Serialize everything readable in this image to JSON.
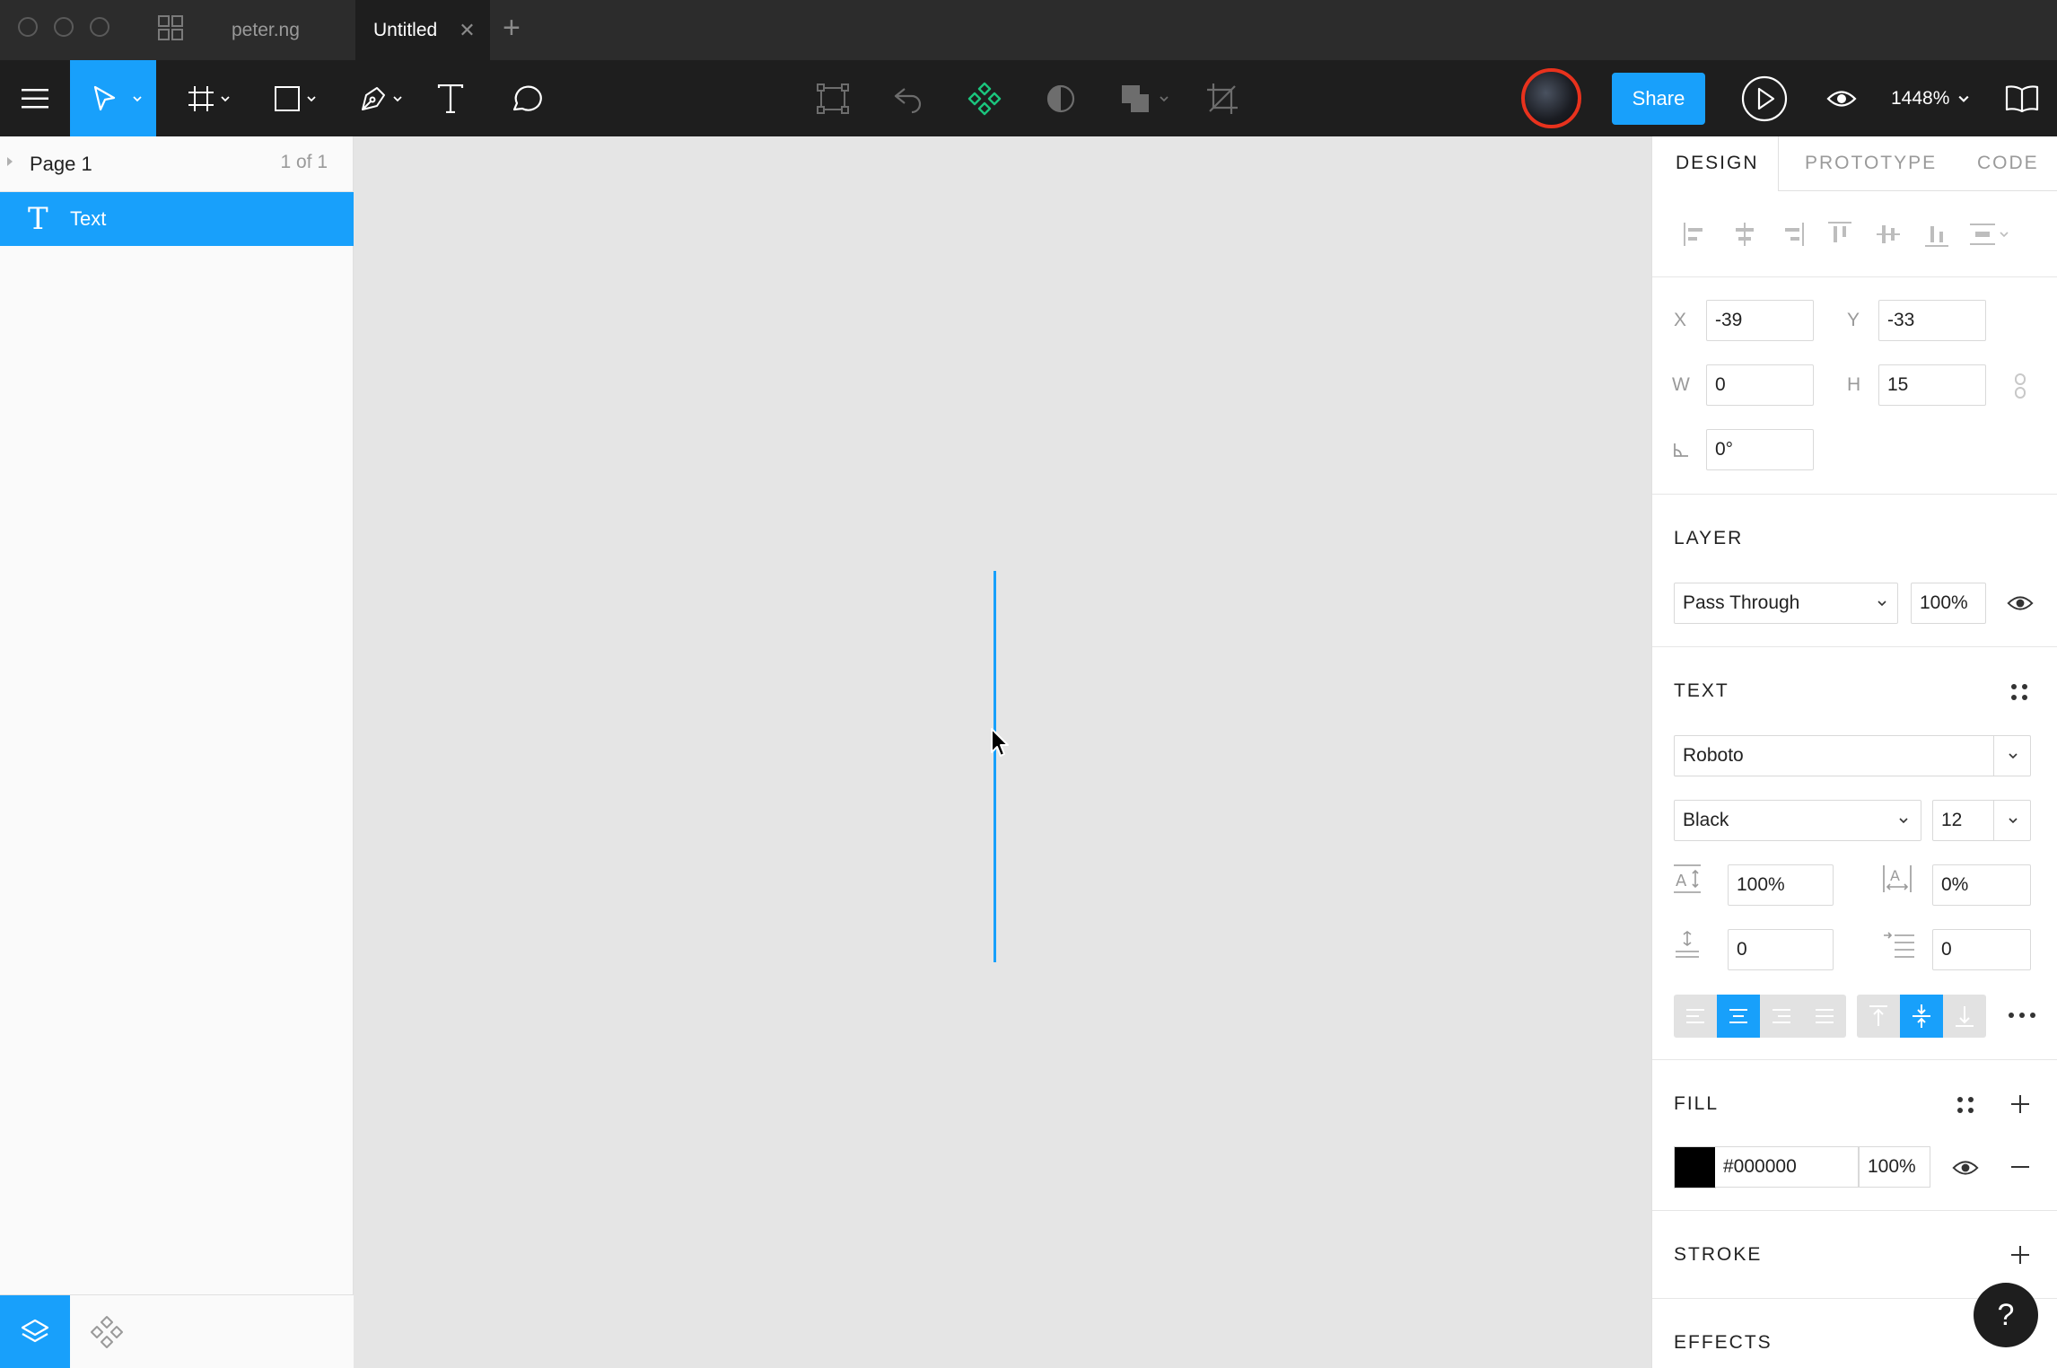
{
  "tabs": [
    {
      "label": "peter.ng",
      "active": false
    },
    {
      "label": "Untitled",
      "active": true
    }
  ],
  "toolbar": {
    "share_label": "Share",
    "zoom_label": "1448%",
    "accent": "#18a0fb"
  },
  "pages": {
    "current": "Page 1",
    "count": "1 of 1"
  },
  "layers": [
    {
      "name": "Text",
      "type": "text",
      "selected": true
    }
  ],
  "right_tabs": [
    "DESIGN",
    "PROTOTYPE",
    "CODE"
  ],
  "transform": {
    "x_label": "X",
    "x": "-39",
    "y_label": "Y",
    "y": "-33",
    "w_label": "W",
    "w": "0",
    "h_label": "H",
    "h": "15",
    "rotation": "0°"
  },
  "layer_section": {
    "title": "LAYER",
    "blend": "Pass Through",
    "opacity": "100%"
  },
  "text_section": {
    "title": "TEXT",
    "font_family": "Roboto",
    "font_weight": "Black",
    "font_size": "12",
    "line_height": "100%",
    "letter_spacing": "0%",
    "paragraph_spacing": "0",
    "paragraph_indent": "0",
    "horizontal_align": "center",
    "vertical_align": "middle"
  },
  "fill_section": {
    "title": "FILL",
    "color_hex": "#000000",
    "opacity": "100%"
  },
  "stroke_section": {
    "title": "STROKE"
  },
  "effects_section": {
    "title": "EFFECTS"
  },
  "help_label": "?"
}
